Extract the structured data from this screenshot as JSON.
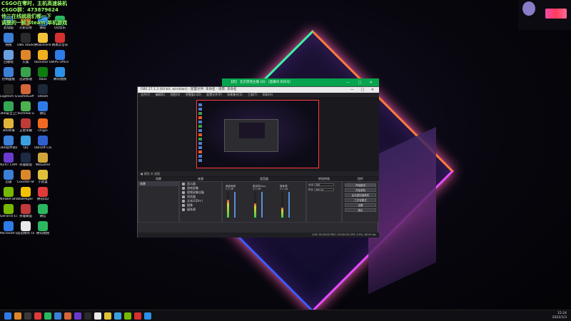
{
  "overlay": {
    "lines": [
      "CSGO在零时，主机高速装机",
      "CSGO群：473879624",
      "他三在线就我们都一下",
      "调整的一帧 steam 单机游戏"
    ]
  },
  "desktop_icons": [
    {
      "label": "此电脑",
      "color": "#3b7fd6"
    },
    {
      "label": "火影忍者",
      "color": "#e0862a"
    },
    {
      "label": "微软",
      "color": "#3a9ce0"
    },
    {
      "label": "QQ音乐",
      "color": "#2bb760"
    },
    {
      "label": "网络",
      "color": "#3b7fd6"
    },
    {
      "label": "OBS Studio",
      "color": "#2a2a2a"
    },
    {
      "label": "腾讯Online",
      "color": "#f2c23a"
    },
    {
      "label": "网易云音乐",
      "color": "#d43030"
    },
    {
      "label": "回收站",
      "color": "#6aa0e0"
    },
    {
      "label": "火狐",
      "color": "#e0862a"
    },
    {
      "label": "Rockstar Games",
      "color": "#f2b01e"
    },
    {
      "label": "WPS Office",
      "color": "#2f7be8"
    },
    {
      "label": "控制面板",
      "color": "#3b7fd6"
    },
    {
      "label": "迅游加速",
      "color": "#3aa14c"
    },
    {
      "label": "Xbox",
      "color": "#107c10"
    },
    {
      "label": "腾讯视频",
      "color": "#2c8fe8"
    },
    {
      "label": "Logitech G HUB",
      "color": "#222222"
    },
    {
      "label": "GameGuff",
      "color": "#d5663a"
    },
    {
      "label": "Steam",
      "color": "#1b2838"
    },
    {
      "label": "",
      "color": "#000000"
    },
    {
      "label": "360安全卫士",
      "color": "#34a853"
    },
    {
      "label": "TechPow GPU-Z",
      "color": "#4caf50"
    },
    {
      "label": "微信",
      "color": "#2f7be8"
    },
    {
      "label": "",
      "color": "#000000"
    },
    {
      "label": "360杀毒",
      "color": "#e0b43a"
    },
    {
      "label": "王者荣耀",
      "color": "#c03a3a"
    },
    {
      "label": "Origin",
      "color": "#f26a22"
    },
    {
      "label": "",
      "color": "#000000"
    },
    {
      "label": "360软件管家",
      "color": "#3b7fd6"
    },
    {
      "label": "QQ",
      "color": "#3aa0e0"
    },
    {
      "label": "Ubisoft Connect",
      "color": "#3060d0"
    },
    {
      "label": "",
      "color": "#000000"
    },
    {
      "label": "NZXT CAM",
      "color": "#6a3ad0"
    },
    {
      "label": "英雄联盟",
      "color": "#1e2a44"
    },
    {
      "label": "WeGame",
      "color": "#d0a63a"
    },
    {
      "label": "",
      "color": "#000000"
    },
    {
      "label": "迅雷",
      "color": "#3b7fd6"
    },
    {
      "label": "Counter-Strike",
      "color": "#d8892a"
    },
    {
      "label": "小黑盒",
      "color": "#e0c23a"
    },
    {
      "label": "",
      "color": "#000000"
    },
    {
      "label": "NVIDIA Broadcast",
      "color": "#76b900"
    },
    {
      "label": "WallPaper Engine",
      "color": "#f2c200"
    },
    {
      "label": "腾讯QQ",
      "color": "#e03a3a"
    },
    {
      "label": "",
      "color": "#000000"
    },
    {
      "label": "GeForce Experience",
      "color": "#76b900"
    },
    {
      "label": "英雄联盟",
      "color": "#c03a3a"
    },
    {
      "label": "微信",
      "color": "#2bb760"
    },
    {
      "label": "",
      "color": "#000000"
    },
    {
      "label": "Microsoft Edge",
      "color": "#2f7be8"
    },
    {
      "label": "反恐精英 Online",
      "color": "#e8e8e8"
    },
    {
      "label": "腾讯视频",
      "color": "#2bb760"
    },
    {
      "label": "",
      "color": "#000000"
    }
  ],
  "green_window": {
    "title": "【新】 北京游戏主播 QQ:（直播间 房间号）",
    "controls": "—  □  ✕"
  },
  "obs": {
    "title": "OBS 27.1.3 (64-bit, windows) - 配置文件: 未命名 - 场景: 未命名",
    "window_controls": "—  □  ✕",
    "menu": [
      "文件(F)",
      "编辑(E)",
      "视图(V)",
      "停靠窗口(D)",
      "配置文件(P)",
      "场景集合(S)",
      "工具(T)",
      "帮助(H)"
    ],
    "status_line": "● 属性    ⚙ 滤镜",
    "docks": {
      "scenes": "场景",
      "sources": "来源",
      "mixer": "混音器",
      "transitions": "转场特效",
      "controls": "控件"
    },
    "scenes": [
      "场景"
    ],
    "sources": [
      "显示器",
      "游戏采集",
      "视频采集设备",
      "浏览器",
      "文本(GDI+)",
      "图像",
      "媒体源"
    ],
    "mixer": [
      {
        "name": "桌面音频",
        "value": "0.0 dB",
        "level": 0.7
      },
      {
        "name": "麦克风/Aux",
        "value": "0.0 dB",
        "level": 0.55
      },
      {
        "name": "媒体源",
        "value": "0.0 dB",
        "level": 0.4
      }
    ],
    "transitions": {
      "type_label": "淡出",
      "type_value": "淡出",
      "duration_label": "时长",
      "duration_value": "300 ms"
    },
    "controls": [
      "开始推流",
      "开始录制",
      "启动虚拟摄像机",
      "工作室模式",
      "设置",
      "退出"
    ],
    "footer": "LIVE: 00:00:00   REC: 00:00:00   CPU: 0.9%, 60.00 fps"
  },
  "taskbar": {
    "time": "15:24",
    "date": "2022/1/3",
    "icons": [
      "#2f7be8",
      "#e0862a",
      "#3a3a3a",
      "#e03a3a",
      "#2bb760",
      "#3b7fd6",
      "#d5663a",
      "#6a3ad0",
      "#2a2a2a",
      "#e8e8e8",
      "#e0c23a",
      "#3aa0e0",
      "#76b900",
      "#d43030",
      "#2c8fe8"
    ]
  }
}
